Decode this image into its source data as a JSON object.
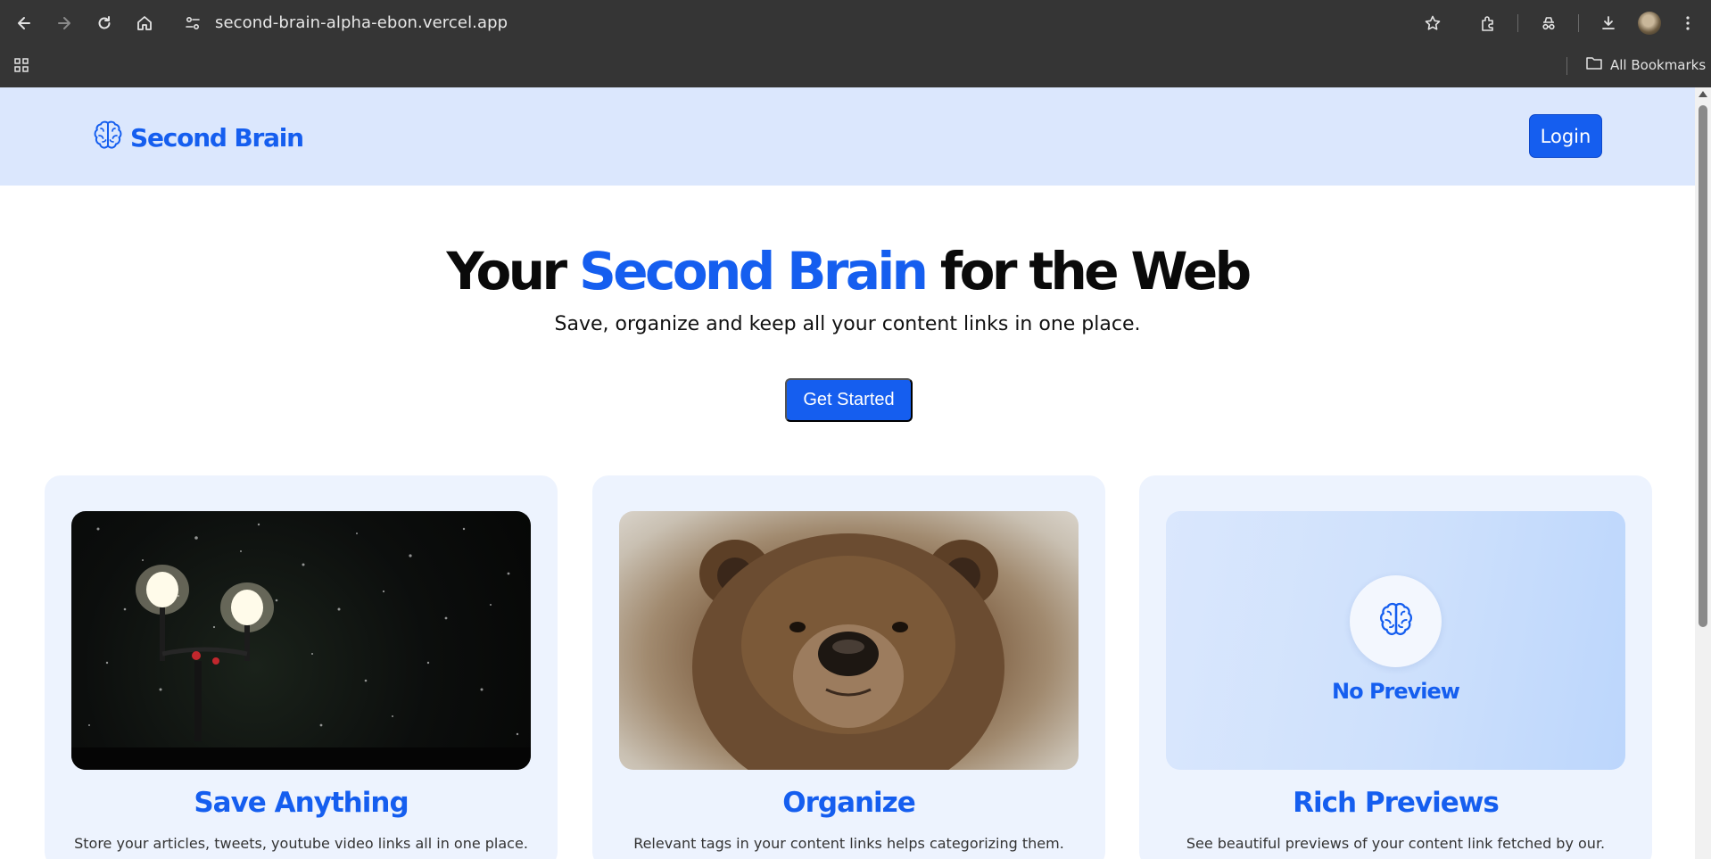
{
  "browser": {
    "url": "second-brain-alpha-ebon.vercel.app",
    "bookmarks_label": "All Bookmarks",
    "icons": [
      "back-icon",
      "forward-icon",
      "reload-icon",
      "home-icon",
      "site-info-icon",
      "star-icon",
      "extensions-icon",
      "incognito-icon",
      "download-icon",
      "profile-avatar",
      "menu-icon",
      "apps-icon",
      "folder-icon"
    ]
  },
  "navbar": {
    "brand": "Second Brain",
    "login_label": "Login",
    "colors": {
      "background": "#dbe7fd",
      "accent": "#155eef"
    }
  },
  "hero": {
    "title_start": "Your ",
    "title_accent": "Second Brain",
    "title_end": " for the Web",
    "subtitle": "Save, organize and keep all your content links in one place.",
    "cta_label": "Get Started"
  },
  "features": [
    {
      "title": "Save Anything",
      "description": "Store your articles, tweets, youtube video links all in one place.",
      "image": "night-street-lamps-photo"
    },
    {
      "title": "Organize",
      "description": "Relevant tags in your content links helps categorizing them.",
      "image": "bear-photo"
    },
    {
      "title": "Rich Previews",
      "description": "See beautiful previews of your content link fetched by our.",
      "image": "no-preview-placeholder",
      "placeholder_label": "No Preview"
    }
  ]
}
